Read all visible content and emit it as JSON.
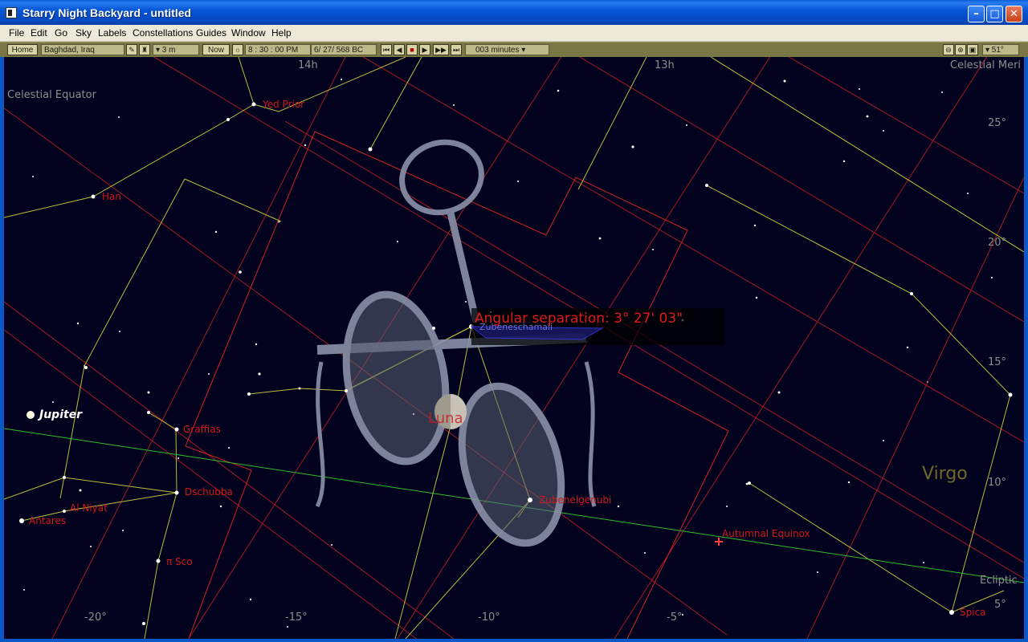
{
  "window": {
    "title": "Starry Night Backyard - untitled"
  },
  "menu": [
    "File",
    "Edit",
    "Go",
    "Sky",
    "Labels",
    "Constellations",
    "Guides",
    "Window",
    "Help"
  ],
  "toolbar": {
    "home_label": "Home",
    "location": "Baghdad, Iraq",
    "elevation": "▾ 3 m",
    "now_label": "Now",
    "time": "8 : 30 : 00 PM",
    "date": "6/ 27/   568 BC",
    "time_step": "003 minutes ▾",
    "fov": "▾ 51°"
  },
  "sky": {
    "ra_labels": [
      "14h",
      "13h"
    ],
    "dec_labels": [
      "25°",
      "20°",
      "15°",
      "10°",
      "5°"
    ],
    "ecl_labels": [
      "-20°",
      "-15°",
      "-10°",
      "-5°"
    ],
    "guide_labels": {
      "celestial_equator": "Celestial Equator",
      "celestial_meridian": "Celestial Meri",
      "ecliptic": "Ecliptic",
      "autumnal_equinox": "Autumnal Equinox"
    },
    "constellation_name": "Virgo",
    "stars": {
      "yed_prior": "Yed Prior",
      "han": "Han",
      "graffias": "Graffias",
      "dschubba": "Dschubba",
      "al_niyat": "Al Niyat",
      "antares": "Antares",
      "pi_sco": "π Sco",
      "zubeneschamali": "Zubeneschamali",
      "zubenelgenubi": "Zubenelgenubi",
      "spica": "Spica"
    },
    "planet": "Jupiter",
    "moon_label": "Luna",
    "measurement": "Angular separation: 3° 27' 03\""
  },
  "colors": {
    "sky": "#02021e",
    "grid": "#c21e1e",
    "boundary": "#b8b832",
    "ecliptic": "#2fbf2f",
    "label": "#d01818",
    "virgo": "#6e6a2a"
  }
}
